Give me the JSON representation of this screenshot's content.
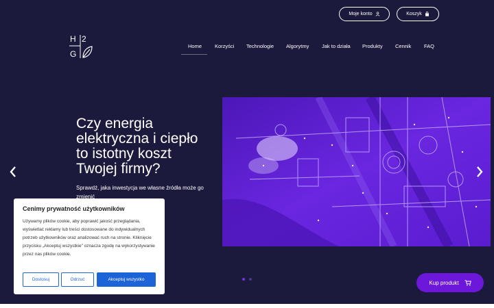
{
  "header": {
    "account_label": "Moje konto",
    "cart_label": "Koszyk",
    "logo_letters": [
      "H",
      "2",
      "G"
    ]
  },
  "nav": {
    "items": [
      {
        "label": "Home",
        "active": true
      },
      {
        "label": "Korzyści"
      },
      {
        "label": "Technologie"
      },
      {
        "label": "Algorytmy"
      },
      {
        "label": "Jak to działa"
      },
      {
        "label": "Produkty"
      },
      {
        "label": "Cennik"
      },
      {
        "label": "FAQ"
      }
    ]
  },
  "hero": {
    "title": "Czy energia elektryczna i ciepło to istotny koszt Twojej firmy?",
    "subtitle": "Sprawdź, jaka inwestycja we własne źródła może go zmienić"
  },
  "cookie": {
    "title": "Cenimy prywatność użytkowników",
    "text": "Używamy plików cookie, aby poprawić jakość przeglądania, wyświetlać reklamy lub treści dostosowane do indywidualnych potrzeb użytkowników oraz analizować ruch na stronie. Kliknięcie przycisku „Akceptuj wszystkie” oznacza zgodę na wykorzystywanie przez nas plików cookie.",
    "customize_label": "Dostosuj",
    "reject_label": "Odrzuć",
    "accept_label": "Akceptuj wszystko"
  },
  "buy_label": "Kup produkt",
  "colors": {
    "background": "#1b1a3c",
    "accent_purple": "#6c17d9",
    "cookie_blue": "#1d63d8"
  }
}
